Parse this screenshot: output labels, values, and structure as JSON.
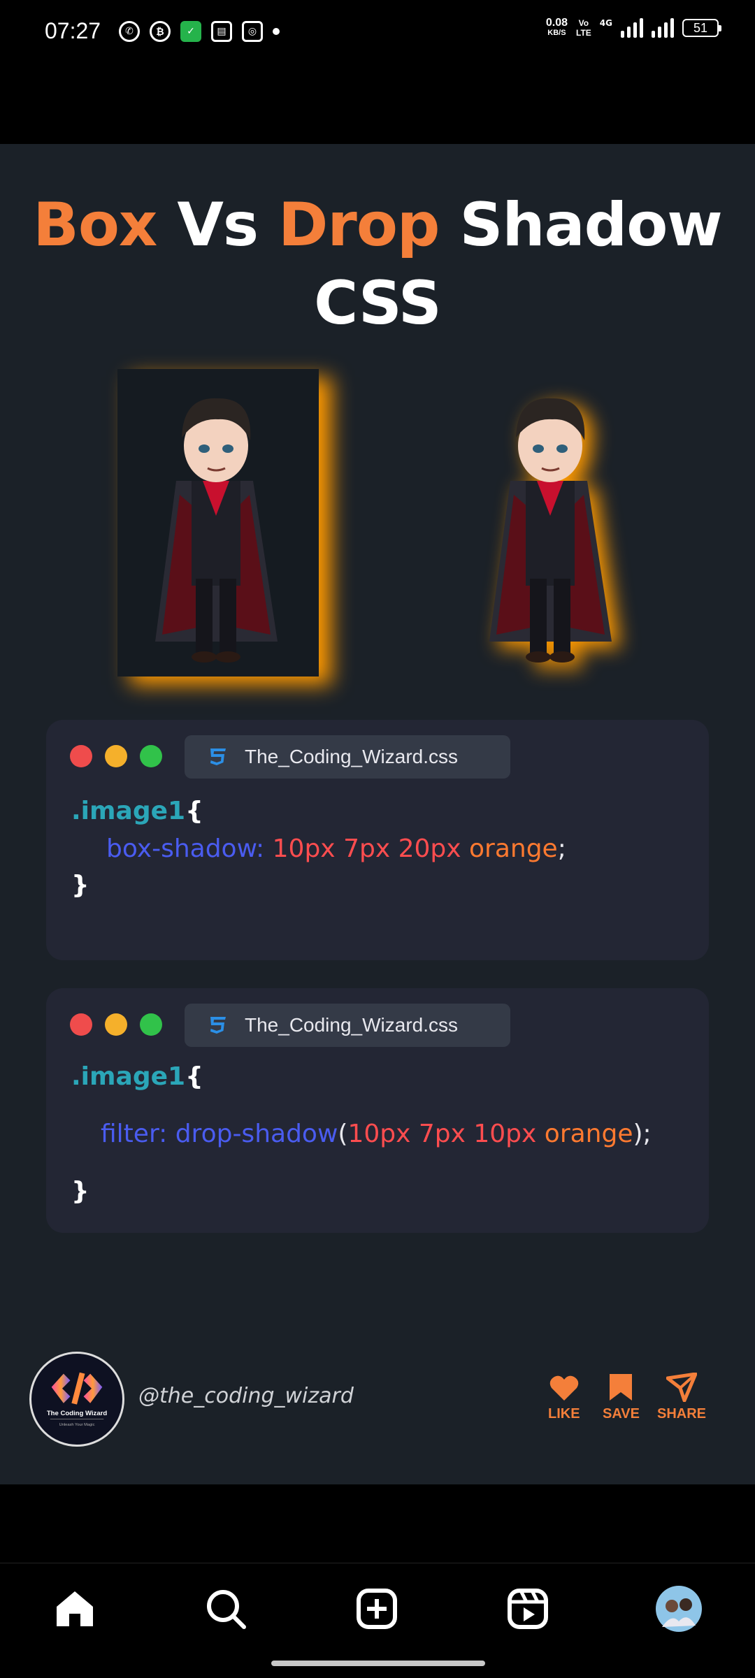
{
  "status_bar": {
    "time": "07:27",
    "net_speed": "0.08",
    "net_unit": "KB/S",
    "volte": "Vo\nLTE",
    "network": "4G",
    "battery": "51"
  },
  "post": {
    "title_part1": "Box",
    "title_part2": "Vs",
    "title_part3": "Drop",
    "title_part4": "Shadow",
    "title_line2": "CSS",
    "snippet1": {
      "filename": "The_Coding_Wizard.css",
      "selector": ".image1",
      "open_brace": "{",
      "property": "box-shadow:",
      "v1": "10px",
      "v2": "7px",
      "v3": "20px",
      "color": "orange",
      "end": ";",
      "close_brace": "}"
    },
    "snippet2": {
      "filename": "The_Coding_Wizard.css",
      "selector": ".image1",
      "open_brace": "{",
      "property": "filter:",
      "func": "drop-shadow",
      "paren_open": "(",
      "v1": "10px",
      "v2": "7px",
      "v3": "10px",
      "color": "orange",
      "end": ");",
      "close_brace": "}"
    },
    "logo_text": "The Coding Wizard",
    "logo_sub": "Unleash Your Magic",
    "handle": "@the_coding_wizard",
    "actions": {
      "like": "LIKE",
      "save": "SAVE",
      "share": "SHARE"
    },
    "accent_color": "#f47f3a"
  },
  "nav": {
    "items": [
      "home-icon",
      "search-icon",
      "create-icon",
      "reels-icon",
      "profile-avatar"
    ]
  }
}
